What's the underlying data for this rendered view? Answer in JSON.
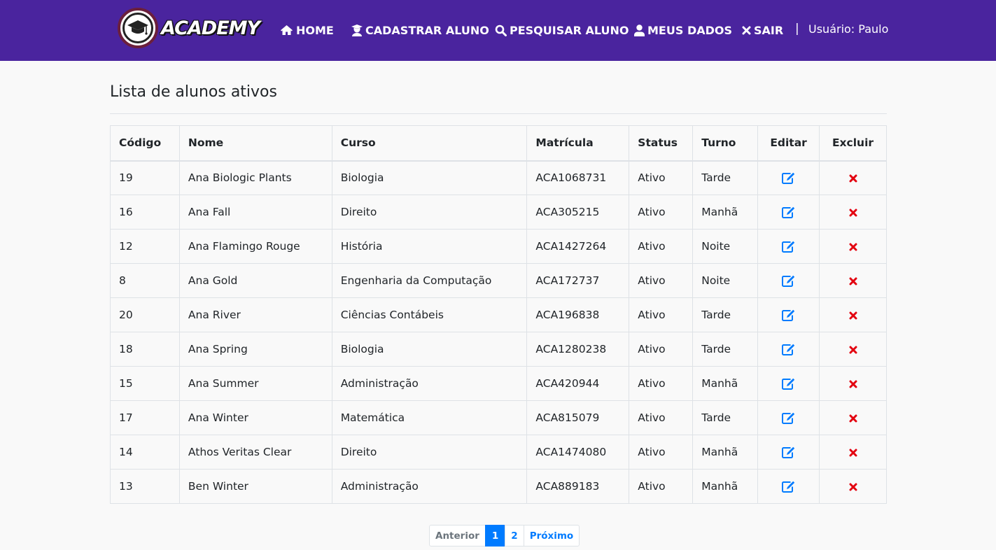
{
  "brand": {
    "name": "ACADEMY",
    "logo_icon": "graduation-cap-icon"
  },
  "nav": {
    "items": [
      {
        "label": "HOME",
        "icon": "home-icon"
      },
      {
        "label": "CADASTRAR ALUNO",
        "icon": "user-graduate-icon"
      },
      {
        "label": "PESQUISAR ALUNO",
        "icon": "search-icon"
      },
      {
        "label": "MEUS DADOS",
        "icon": "user-icon"
      },
      {
        "label": "SAIR",
        "icon": "close-icon"
      }
    ],
    "separator": "|",
    "user": "Usuário: Paulo"
  },
  "page": {
    "title": "Lista de alunos ativos"
  },
  "table": {
    "headers": [
      "Código",
      "Nome",
      "Curso",
      "Matrícula",
      "Status",
      "Turno",
      "Editar",
      "Excluir"
    ],
    "rows": [
      {
        "codigo": "19",
        "nome": "Ana Biologic Plants",
        "curso": "Biologia",
        "matricula": "ACA1068731",
        "status": "Ativo",
        "turno": "Tarde"
      },
      {
        "codigo": "16",
        "nome": "Ana Fall",
        "curso": "Direito",
        "matricula": "ACA305215",
        "status": "Ativo",
        "turno": "Manhã"
      },
      {
        "codigo": "12",
        "nome": "Ana Flamingo Rouge",
        "curso": "História",
        "matricula": "ACA1427264",
        "status": "Ativo",
        "turno": "Noite"
      },
      {
        "codigo": "8",
        "nome": "Ana Gold",
        "curso": "Engenharia da Computação",
        "matricula": "ACA172737",
        "status": "Ativo",
        "turno": "Noite"
      },
      {
        "codigo": "20",
        "nome": "Ana River",
        "curso": "Ciências Contábeis",
        "matricula": "ACA196838",
        "status": "Ativo",
        "turno": "Tarde"
      },
      {
        "codigo": "18",
        "nome": "Ana Spring",
        "curso": "Biologia",
        "matricula": "ACA1280238",
        "status": "Ativo",
        "turno": "Tarde"
      },
      {
        "codigo": "15",
        "nome": "Ana Summer",
        "curso": "Administração",
        "matricula": "ACA420944",
        "status": "Ativo",
        "turno": "Manhã"
      },
      {
        "codigo": "17",
        "nome": "Ana Winter",
        "curso": "Matemática",
        "matricula": "ACA815079",
        "status": "Ativo",
        "turno": "Tarde"
      },
      {
        "codigo": "14",
        "nome": "Athos Veritas Clear",
        "curso": "Direito",
        "matricula": "ACA1474080",
        "status": "Ativo",
        "turno": "Manhã"
      },
      {
        "codigo": "13",
        "nome": "Ben Winter",
        "curso": "Administração",
        "matricula": "ACA889183",
        "status": "Ativo",
        "turno": "Manhã"
      }
    ],
    "edit_icon": "edit-icon",
    "delete_icon": "delete-x-icon"
  },
  "pagination": {
    "previous": "Anterior",
    "pages": [
      "1",
      "2"
    ],
    "current": "1",
    "next": "Próximo"
  },
  "colors": {
    "navbar": "#4a249e",
    "accent": "#007bff",
    "delete": "#e3000f",
    "background": "#f9f9f9"
  }
}
